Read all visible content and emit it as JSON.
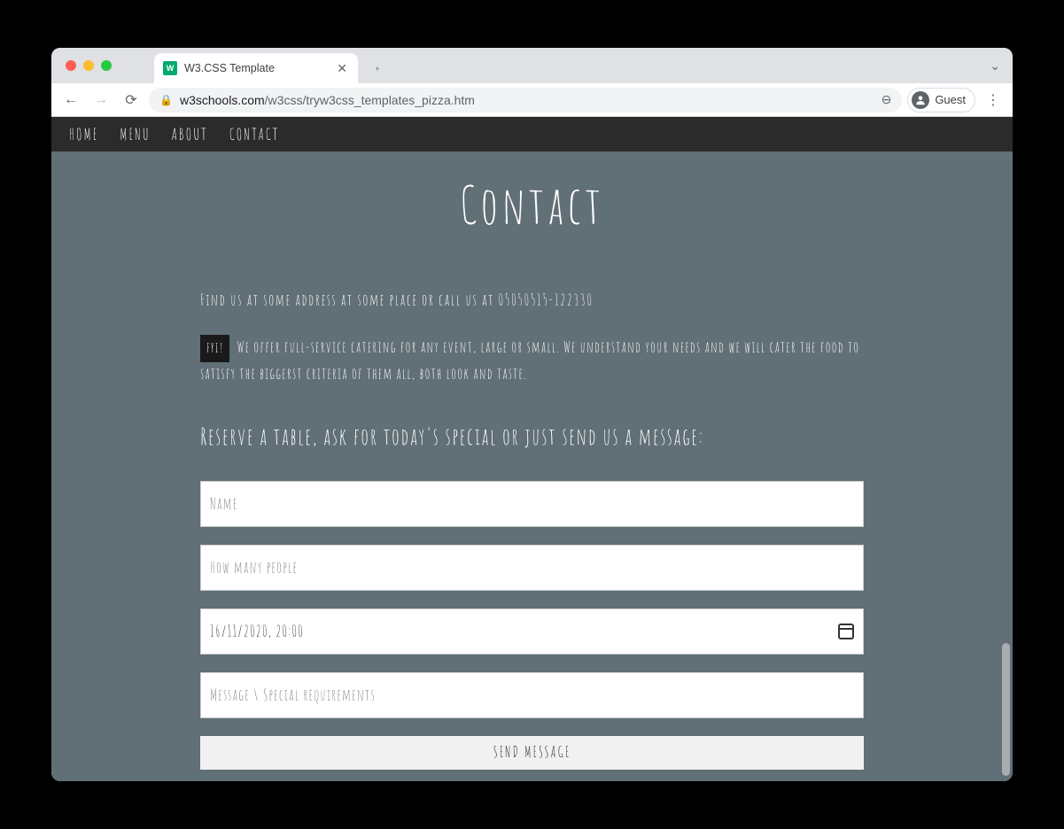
{
  "browser": {
    "tab_title": "W3.CSS Template",
    "favicon_text": "W",
    "guest_label": "Guest",
    "url_host": "w3schools.com",
    "url_path": "/w3css/tryw3css_templates_pizza.htm"
  },
  "nav": {
    "items": [
      "HOME",
      "MENU",
      "ABOUT",
      "CONTACT"
    ]
  },
  "contact": {
    "title": "Contact",
    "find_us": "Find us at some address at some place or call us at 05050515-122330",
    "fyi_tag": "FYI!",
    "fyi_text": "We offer full-service catering for any event, large or small. We understand your needs and we will cater the food to satisfy the biggerst criteria of them all, both look and taste.",
    "reserve": "Reserve a table, ask for today's special or just send us a message:",
    "form": {
      "name_placeholder": "Name",
      "people_placeholder": "How many people",
      "datetime_value": "16/11/2020, 20:00",
      "message_placeholder": "Message \\ Special requirements",
      "submit_label": "SEND MESSAGE"
    }
  }
}
